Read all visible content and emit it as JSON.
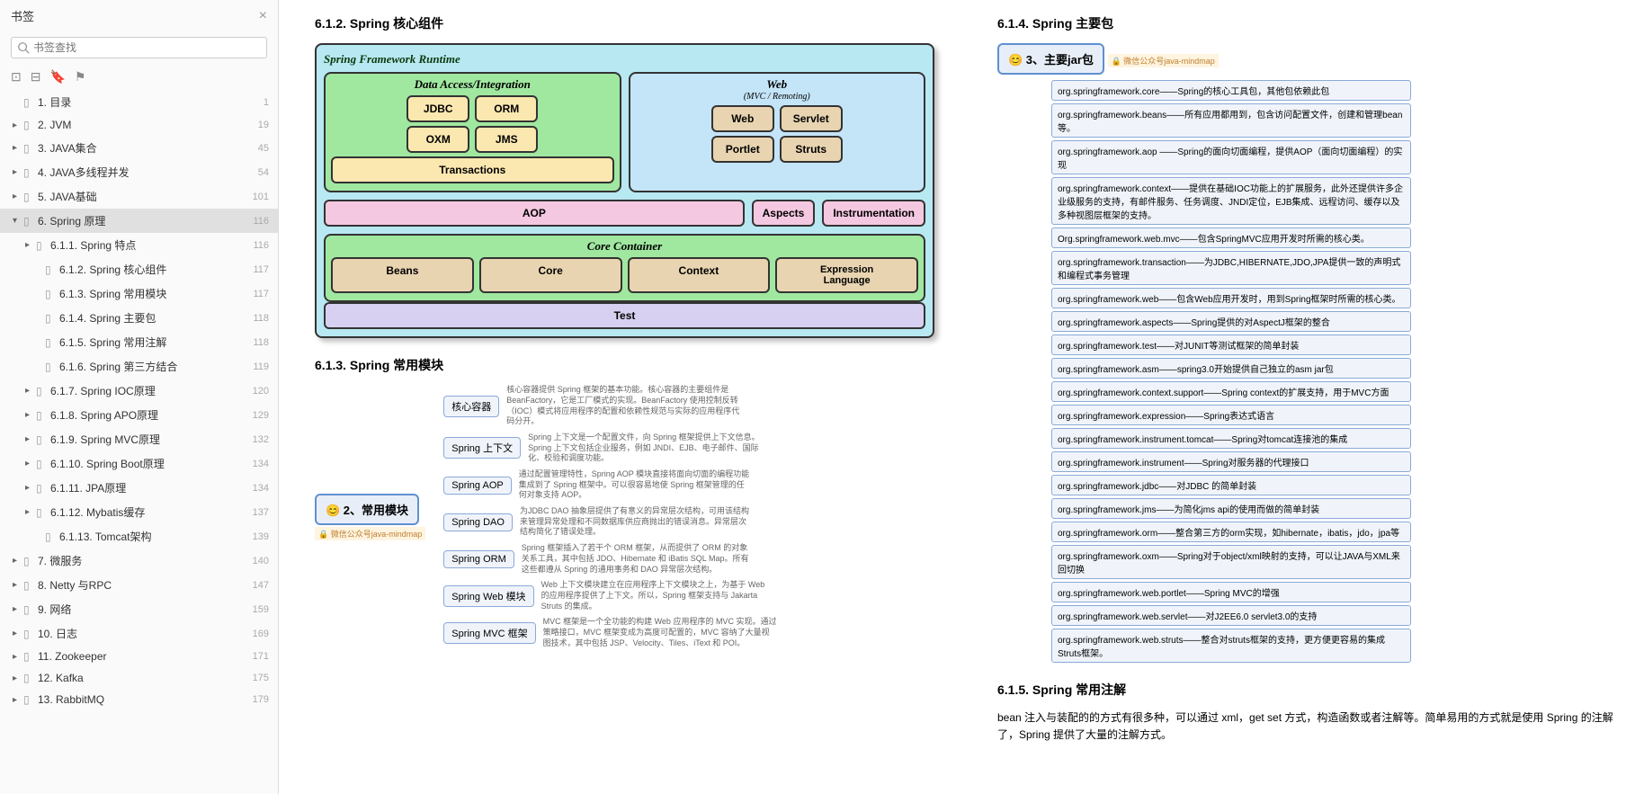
{
  "sidebar": {
    "title": "书签",
    "search_placeholder": "书签查找",
    "items": [
      {
        "arrow": "",
        "icon": "▯",
        "label": "1. 目录",
        "page": "1",
        "pad": 14
      },
      {
        "arrow": "▸",
        "icon": "▯",
        "label": "2. JVM",
        "page": "19",
        "pad": 14
      },
      {
        "arrow": "▸",
        "icon": "▯",
        "label": "3. JAVA集合",
        "page": "45",
        "pad": 14
      },
      {
        "arrow": "▸",
        "icon": "▯",
        "label": "4. JAVA多线程并发",
        "page": "54",
        "pad": 14
      },
      {
        "arrow": "▸",
        "icon": "▯",
        "label": "5. JAVA基础",
        "page": "101",
        "pad": 14
      },
      {
        "arrow": "▾",
        "icon": "▯",
        "label": "6. Spring 原理",
        "page": "116",
        "pad": 14,
        "sel": true
      },
      {
        "arrow": "▸",
        "icon": "▯",
        "label": "6.1.1. Spring 特点",
        "page": "116",
        "pad": 28
      },
      {
        "arrow": "",
        "icon": "▯",
        "label": "6.1.2. Spring 核心组件",
        "page": "117",
        "pad": 38
      },
      {
        "arrow": "",
        "icon": "▯",
        "label": "6.1.3. Spring 常用模块",
        "page": "117",
        "pad": 38
      },
      {
        "arrow": "",
        "icon": "▯",
        "label": "6.1.4. Spring 主要包",
        "page": "118",
        "pad": 38
      },
      {
        "arrow": "",
        "icon": "▯",
        "label": "6.1.5. Spring 常用注解",
        "page": "118",
        "pad": 38
      },
      {
        "arrow": "",
        "icon": "▯",
        "label": "6.1.6. Spring 第三方结合",
        "page": "119",
        "pad": 38
      },
      {
        "arrow": "▸",
        "icon": "▯",
        "label": "6.1.7. Spring IOC原理",
        "page": "120",
        "pad": 28
      },
      {
        "arrow": "▸",
        "icon": "▯",
        "label": "6.1.8. Spring APO原理",
        "page": "129",
        "pad": 28
      },
      {
        "arrow": "▸",
        "icon": "▯",
        "label": "6.1.9. Spring MVC原理",
        "page": "132",
        "pad": 28
      },
      {
        "arrow": "▸",
        "icon": "▯",
        "label": "6.1.10. Spring Boot原理",
        "page": "134",
        "pad": 28
      },
      {
        "arrow": "▸",
        "icon": "▯",
        "label": "6.1.11. JPA原理",
        "page": "134",
        "pad": 28
      },
      {
        "arrow": "▸",
        "icon": "▯",
        "label": "6.1.12. Mybatis缓存",
        "page": "137",
        "pad": 28
      },
      {
        "arrow": "",
        "icon": "▯",
        "label": "6.1.13. Tomcat架构",
        "page": "139",
        "pad": 38
      },
      {
        "arrow": "▸",
        "icon": "▯",
        "label": "7.  微服务",
        "page": "140",
        "pad": 14
      },
      {
        "arrow": "▸",
        "icon": "▯",
        "label": "8. Netty 与RPC",
        "page": "147",
        "pad": 14
      },
      {
        "arrow": "▸",
        "icon": "▯",
        "label": "9. 网络",
        "page": "159",
        "pad": 14
      },
      {
        "arrow": "▸",
        "icon": "▯",
        "label": "10. 日志",
        "page": "169",
        "pad": 14
      },
      {
        "arrow": "▸",
        "icon": "▯",
        "label": "11. Zookeeper",
        "page": "171",
        "pad": 14
      },
      {
        "arrow": "▸",
        "icon": "▯",
        "label": "12. Kafka",
        "page": "175",
        "pad": 14
      },
      {
        "arrow": "▸",
        "icon": "▯",
        "label": "13. RabbitMQ",
        "page": "179",
        "pad": 14
      }
    ]
  },
  "h612": "6.1.2.  Spring 核心组件",
  "h613": "6.1.3.  Spring 常用模块",
  "h614": "6.1.4.  Spring 主要包",
  "h615": "6.1.5.  Spring 常用注解",
  "diag": {
    "title": "Spring Framework Runtime",
    "data_title": "Data Access/Integration",
    "web_title": "Web",
    "web_sub": "(MVC / Remoting)",
    "jdbc": "JDBC",
    "orm": "ORM",
    "oxm": "OXM",
    "jms": "JMS",
    "txn": "Transactions",
    "web": "Web",
    "servlet": "Servlet",
    "portlet": "Portlet",
    "struts": "Struts",
    "aop": "AOP",
    "aspects": "Aspects",
    "instr": "Instrumentation",
    "core_title": "Core Container",
    "beans": "Beans",
    "core": "Core",
    "context": "Context",
    "el": "Expression\nLanguage",
    "test": "Test"
  },
  "mm2": {
    "root": "😊 2、常用模块",
    "cap": "🔒 微信公众号java-mindmap",
    "nodes": [
      {
        "n": "核心容器",
        "d": "核心容器提供 Spring 框架的基本功能。核心容器的主要组件是 BeanFactory，它是工厂模式的实现。BeanFactory 使用控制反转（IOC）模式将应用程序的配置和依赖性规范与实际的应用程序代码分开。"
      },
      {
        "n": "Spring 上下文",
        "d": "Spring 上下文是一个配置文件，向 Spring 框架提供上下文信息。Spring 上下文包括企业服务，例如 JNDI、EJB、电子邮件、国际化、校验和调度功能。"
      },
      {
        "n": "Spring AOP",
        "d": "通过配置管理特性，Spring AOP 模块直接将面向切面的编程功能集成到了 Spring 框架中。可以很容易地使 Spring 框架管理的任何对象支持 AOP。"
      },
      {
        "n": "Spring DAO",
        "d": "为JDBC DAO 抽象层提供了有意义的异常层次结构，可用该结构来管理异常处理和不同数据库供应商抛出的错误消息。异常层次结构简化了错误处理。"
      },
      {
        "n": "Spring ORM",
        "d": "Spring 框架插入了若干个 ORM 框架，从而提供了 ORM 的对象关系工具，其中包括 JDO、Hibernate 和 iBatis SQL Map。所有这些都遵从 Spring 的通用事务和 DAO 异常层次结构。"
      },
      {
        "n": "Spring Web 模块",
        "d": "Web 上下文模块建立在应用程序上下文模块之上，为基于 Web 的应用程序提供了上下文。所以，Spring 框架支持与 Jakarta Struts 的集成。"
      },
      {
        "n": "Spring MVC 框架",
        "d": "MVC 框架是一个全功能的构建 Web 应用程序的 MVC 实现。通过策略接口，MVC 框架变成为高度可配置的，MVC 容纳了大量视图技术，其中包括 JSP、Velocity、Tiles、iText 和 POI。"
      }
    ]
  },
  "mm3": {
    "root": "😊 3、主要jar包",
    "cap": "🔒 微信公众号java-mindmap",
    "items": [
      "org.springframework.core——Spring的核心工具包，其他包依赖此包",
      "org.springframework.beans——所有应用都用到，包含访问配置文件，创建和管理bean等。",
      "org.springframework.aop ——Spring的面向切面编程，提供AOP（面向切面编程）的实现",
      "org.springframework.context——提供在基础IOC功能上的扩展服务，此外还提供许多企业级服务的支持，有邮件服务、任务调度、JNDI定位，EJB集成、远程访问、缓存以及多种视图层框架的支持。",
      "Org.springframework.web.mvc——包含SpringMVC应用开发时所需的核心类。",
      "org.springframework.transaction——为JDBC,HIBERNATE,JDO,JPA提供一致的声明式和编程式事务管理",
      "org.springframework.web——包含Web应用开发时，用到Spring框架时所需的核心类。",
      "org.springframework.aspects——Spring提供的对AspectJ框架的整合",
      "org.springframework.test——对JUNIT等测试框架的简单封装",
      "org.springframework.asm——spring3.0开始提供自己独立的asm jar包",
      "org.springframework.context.support——Spring context的扩展支持，用于MVC方面",
      "org.springframework.expression——Spring表达式语言",
      "org.springframework.instrument.tomcat——Spring对tomcat连接池的集成",
      "org.springframework.instrument——Spring对服务器的代理接口",
      "org.springframework.jdbc——对JDBC 的简单封装",
      "org.springframework.jms——为简化jms api的使用而做的简单封装",
      "org.springframework.orm——整合第三方的orm实现，如hibernate，ibatis，jdo，jpa等",
      "org.springframework.oxm——Spring对于object/xml映射的支持，可以让JAVA与XML来回切换",
      "org.springframework.web.portlet——Spring MVC的增强",
      "org.springframework.web.servlet——对J2EE6.0 servlet3.0的支持",
      "org.springframework.web.struts——整合对struts框架的支持，更方便更容易的集成Struts框架。"
    ]
  },
  "p615": "bean 注入与装配的的方式有很多种，可以通过 xml，get set 方式，构造函数或者注解等。简单易用的方式就是使用 Spring 的注解了，Spring 提供了大量的注解方式。"
}
